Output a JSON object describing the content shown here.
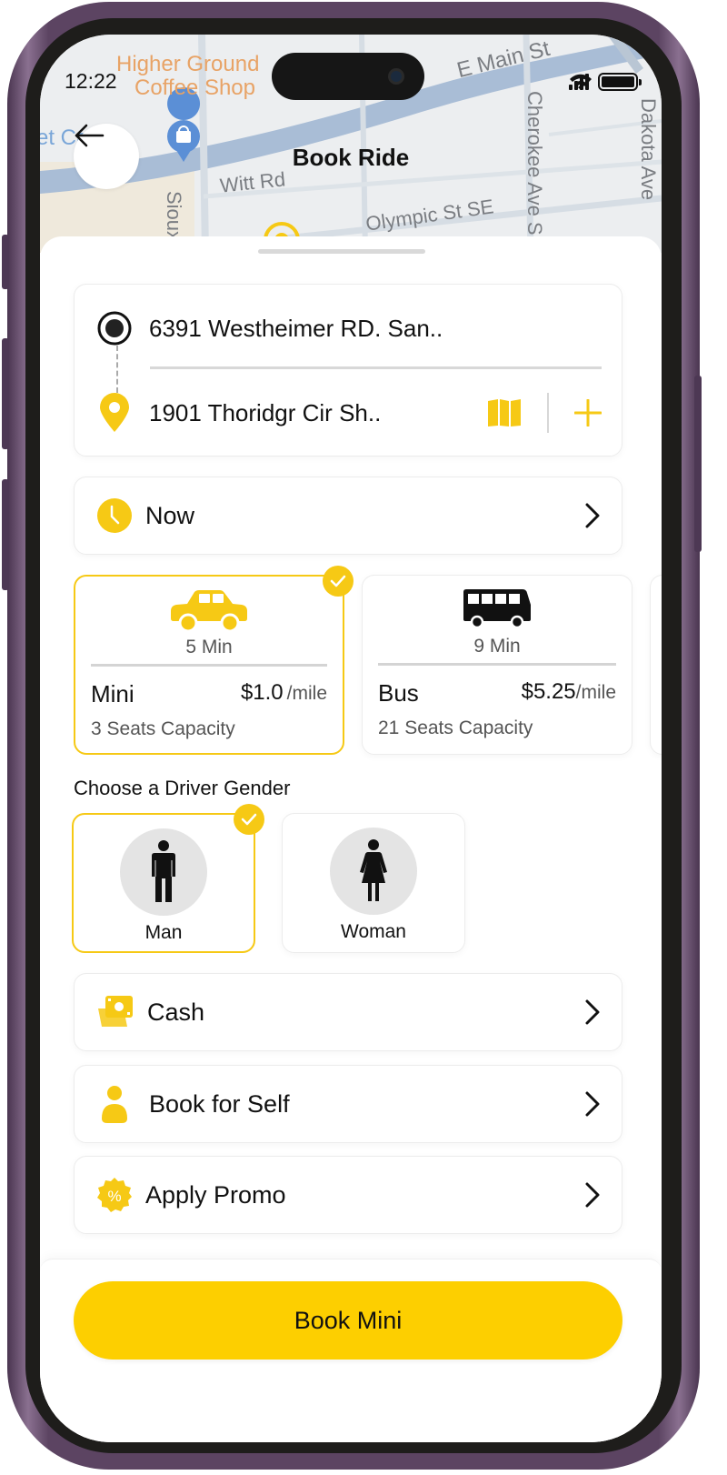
{
  "status_bar": {
    "time": "12:22",
    "icons": [
      "cellular-signal-icon",
      "wifi-icon",
      "battery-icon"
    ]
  },
  "map": {
    "labels": {
      "poi_line1": "Higher Ground",
      "poi_line2": "Coffee Shop",
      "street_main": "E Main St",
      "street_witt": "Witt Rd",
      "street_sioux": "Sioux",
      "street_olympic": "Olympic St SE",
      "street_cherokee": "Cherokee Ave S",
      "street_dakota": "Dakota Ave",
      "blue_place": "et Ca    is"
    }
  },
  "header": {
    "title": "Book Ride",
    "back_icon": "arrow-left-icon"
  },
  "route": {
    "pickup": "6391 Westheimer RD. San..",
    "dropoff": "1901 Thoridgr Cir Sh..",
    "pickup_icon": "radio-target-icon",
    "dropoff_icon": "location-pin-icon",
    "map_icon": "map-icon",
    "add_icon": "plus-icon"
  },
  "schedule": {
    "label": "Now",
    "icon": "clock-icon"
  },
  "vehicles": [
    {
      "name": "Mini",
      "eta": "5 Min",
      "price": "$1.0",
      "unit": "/mile",
      "capacity": "3 Seats Capacity",
      "icon": "car-icon",
      "selected": true
    },
    {
      "name": "Bus",
      "eta": "9 Min",
      "price": "$5.25",
      "unit": "/mile",
      "capacity": "21 Seats Capacity",
      "icon": "bus-icon",
      "selected": false
    }
  ],
  "driver_gender": {
    "label": "Choose a Driver Gender",
    "options": [
      {
        "label": "Man",
        "icon": "man-icon",
        "selected": true
      },
      {
        "label": "Woman",
        "icon": "woman-icon",
        "selected": false
      }
    ]
  },
  "options": [
    {
      "label": "Cash",
      "icon": "cash-icon"
    },
    {
      "label": "Book for Self",
      "icon": "person-icon"
    },
    {
      "label": "Apply Promo",
      "icon": "promo-badge-icon"
    }
  ],
  "cta": {
    "label": "Book Mini"
  },
  "colors": {
    "accent": "#fdcf00",
    "accent_border": "#f6c915",
    "text": "#111111",
    "muted": "#555555"
  }
}
